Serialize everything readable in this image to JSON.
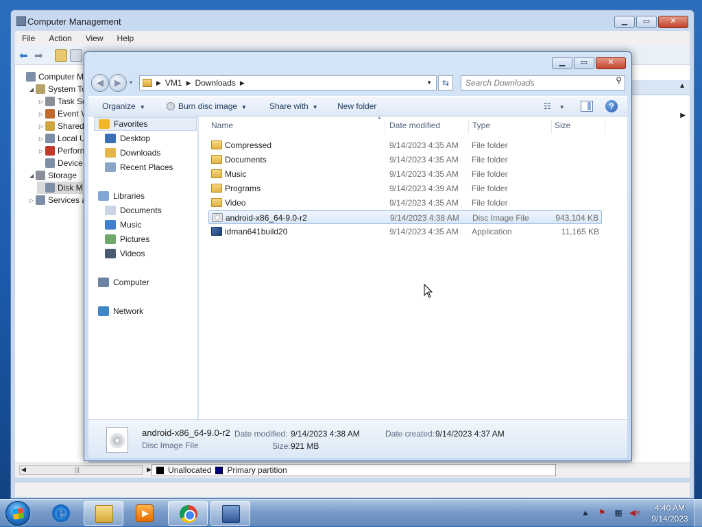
{
  "computer_management": {
    "title": "Computer Management",
    "menu": [
      "File",
      "Action",
      "View",
      "Help"
    ],
    "tree": [
      {
        "label": "Computer Ma",
        "level": 0,
        "expand": ""
      },
      {
        "label": "System To",
        "level": 1,
        "expand": "◢"
      },
      {
        "label": "Task Sc",
        "level": 2,
        "expand": "▷"
      },
      {
        "label": "Event V",
        "level": 2,
        "expand": "▷"
      },
      {
        "label": "Shared",
        "level": 2,
        "expand": "▷"
      },
      {
        "label": "Local U",
        "level": 2,
        "expand": "▷"
      },
      {
        "label": "Perforn",
        "level": 2,
        "expand": "▷"
      },
      {
        "label": "Device",
        "level": 2,
        "expand": ""
      },
      {
        "label": "Storage",
        "level": 1,
        "expand": "◢"
      },
      {
        "label": "Disk M",
        "level": 2,
        "expand": ""
      },
      {
        "label": "Services ar",
        "level": 1,
        "expand": "▷"
      }
    ],
    "legend": {
      "unallocated": "Unallocated",
      "primary": "Primary partition"
    },
    "colors": {
      "unallocated": "#000000",
      "primary": "#000080"
    }
  },
  "explorer": {
    "address": {
      "root": "VM1",
      "folder": "Downloads"
    },
    "search_placeholder": "Search Downloads",
    "commands": {
      "organize": "Organize",
      "burn": "Burn disc image",
      "share": "Share with",
      "new_folder": "New folder"
    },
    "nav": [
      {
        "label": "Favorites",
        "group": true,
        "icon": "star-icon"
      },
      {
        "label": "Desktop",
        "group": false,
        "icon": "desktop-icon"
      },
      {
        "label": "Downloads",
        "group": false,
        "icon": "downloads-icon"
      },
      {
        "label": "Recent Places",
        "group": false,
        "icon": "recent-places-icon"
      },
      {
        "label": "Libraries",
        "group": true,
        "icon": "libraries-icon"
      },
      {
        "label": "Documents",
        "group": false,
        "icon": "documents-icon"
      },
      {
        "label": "Music",
        "group": false,
        "icon": "music-icon"
      },
      {
        "label": "Pictures",
        "group": false,
        "icon": "pictures-icon"
      },
      {
        "label": "Videos",
        "group": false,
        "icon": "videos-icon"
      },
      {
        "label": "Computer",
        "group": true,
        "icon": "computer-icon"
      },
      {
        "label": "Network",
        "group": true,
        "icon": "network-icon"
      }
    ],
    "columns": {
      "name": "Name",
      "date": "Date modified",
      "type": "Type",
      "size": "Size"
    },
    "files": [
      {
        "name": "Compressed",
        "date": "9/14/2023 4:35 AM",
        "type": "File folder",
        "size": "",
        "icon": "folder"
      },
      {
        "name": "Documents",
        "date": "9/14/2023 4:35 AM",
        "type": "File folder",
        "size": "",
        "icon": "folder"
      },
      {
        "name": "Music",
        "date": "9/14/2023 4:35 AM",
        "type": "File folder",
        "size": "",
        "icon": "folder"
      },
      {
        "name": "Programs",
        "date": "9/14/2023 4:39 AM",
        "type": "File folder",
        "size": "",
        "icon": "folder"
      },
      {
        "name": "Video",
        "date": "9/14/2023 4:35 AM",
        "type": "File folder",
        "size": "",
        "icon": "folder"
      },
      {
        "name": "android-x86_64-9.0-r2",
        "date": "9/14/2023 4:38 AM",
        "type": "Disc Image File",
        "size": "943,104 KB",
        "icon": "disc",
        "selected": true
      },
      {
        "name": "idman641build20",
        "date": "9/14/2023 4:35 AM",
        "type": "Application",
        "size": "11,165 KB",
        "icon": "app"
      }
    ],
    "details": {
      "name": "android-x86_64-9.0-r2",
      "type": "Disc Image File",
      "date_modified_label": "Date modified:",
      "date_modified": "9/14/2023 4:38 AM",
      "date_created_label": "Date created:",
      "date_created": "9/14/2023 4:37 AM",
      "size_label": "Size:",
      "size": "921 MB"
    }
  },
  "taskbar": {
    "time": "4:40 AM",
    "date": "9/14/2023"
  }
}
